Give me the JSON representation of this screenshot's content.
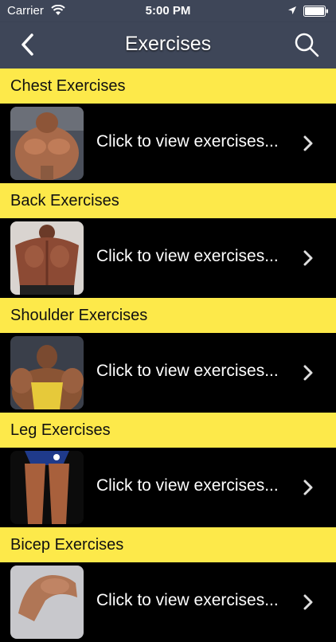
{
  "status": {
    "carrier": "Carrier",
    "time": "5:00 PM"
  },
  "nav": {
    "title": "Exercises"
  },
  "sections": [
    {
      "title": "Chest Exercises",
      "row_label": "Click to view exercises..."
    },
    {
      "title": "Back Exercises",
      "row_label": "Click to view exercises..."
    },
    {
      "title": "Shoulder Exercises",
      "row_label": "Click to view exercises..."
    },
    {
      "title": "Leg Exercises",
      "row_label": "Click to view exercises..."
    },
    {
      "title": "Bicep Exercises",
      "row_label": "Click to view exercises..."
    }
  ],
  "colors": {
    "nav_bg": "#3e4658",
    "header_bg": "#fde94a",
    "row_bg": "#000000"
  }
}
